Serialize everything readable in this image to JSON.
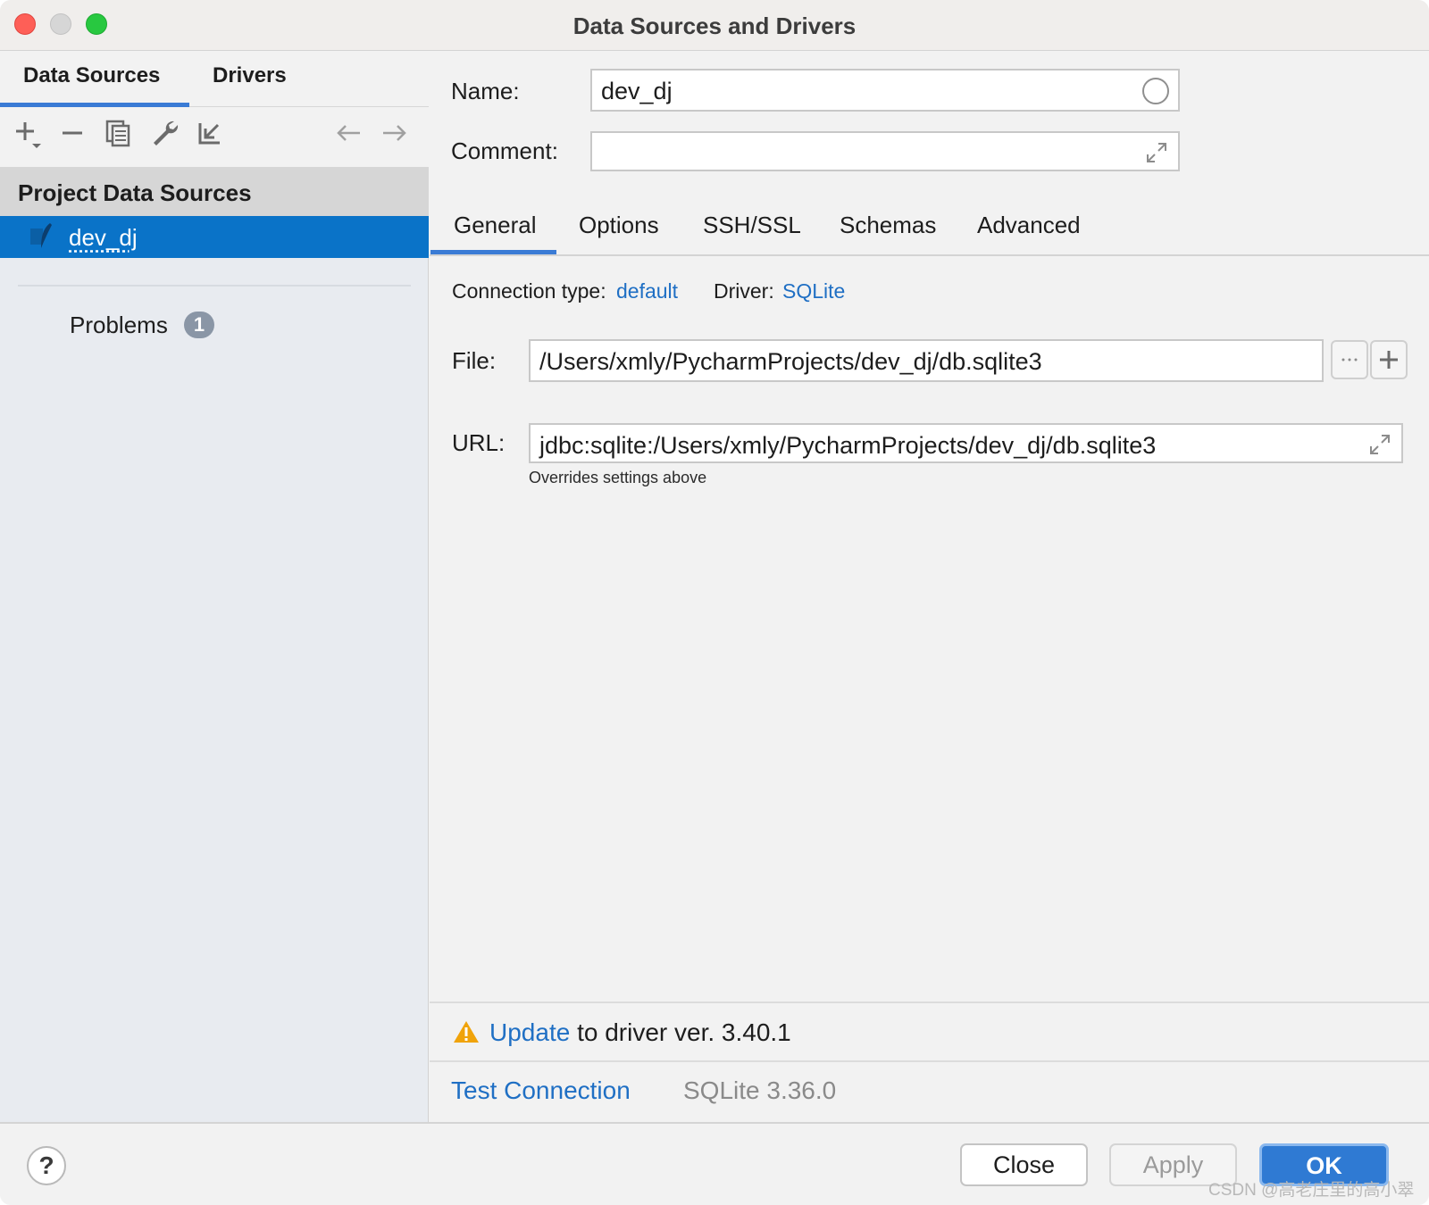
{
  "window": {
    "title": "Data Sources and Drivers"
  },
  "left": {
    "tabs": [
      {
        "label": "Data Sources",
        "active": true
      },
      {
        "label": "Drivers",
        "active": false
      }
    ],
    "toolbar": {
      "icons": [
        "add-icon",
        "remove-icon",
        "duplicate-icon",
        "wrench-icon",
        "import-icon",
        "back-arrow-icon",
        "forward-arrow-icon"
      ]
    },
    "section_title": "Project Data Sources",
    "selected_item": "dev_dj",
    "problems": {
      "label": "Problems",
      "count": "1"
    }
  },
  "right": {
    "name_label": "Name:",
    "name_value": "dev_dj",
    "comment_label": "Comment:",
    "comment_value": "",
    "tabs": [
      {
        "label": "General",
        "active": true
      },
      {
        "label": "Options",
        "active": false
      },
      {
        "label": "SSH/SSL",
        "active": false
      },
      {
        "label": "Schemas",
        "active": false
      },
      {
        "label": "Advanced",
        "active": false
      }
    ],
    "connection_type_label": "Connection type:",
    "connection_type_value": "default",
    "driver_label": "Driver:",
    "driver_value": "SQLite",
    "file_label": "File:",
    "file_value": "/Users/xmly/PycharmProjects/dev_dj/db.sqlite3",
    "url_label": "URL:",
    "url_value": "jdbc:sqlite:/Users/xmly/PycharmProjects/dev_dj/db.sqlite3",
    "url_hint": "Overrides settings above",
    "update_link": "Update",
    "update_text": " to driver ver. 3.40.1",
    "test_connection": "Test Connection",
    "driver_version": "SQLite 3.36.0"
  },
  "footer": {
    "help": "?",
    "close": "Close",
    "apply": "Apply",
    "ok": "OK",
    "watermark": "CSDN @高老庄里的高小翠"
  },
  "colors": {
    "accent": "#0a73c8",
    "link": "#1f6fc4",
    "warning": "#f0a30a"
  }
}
